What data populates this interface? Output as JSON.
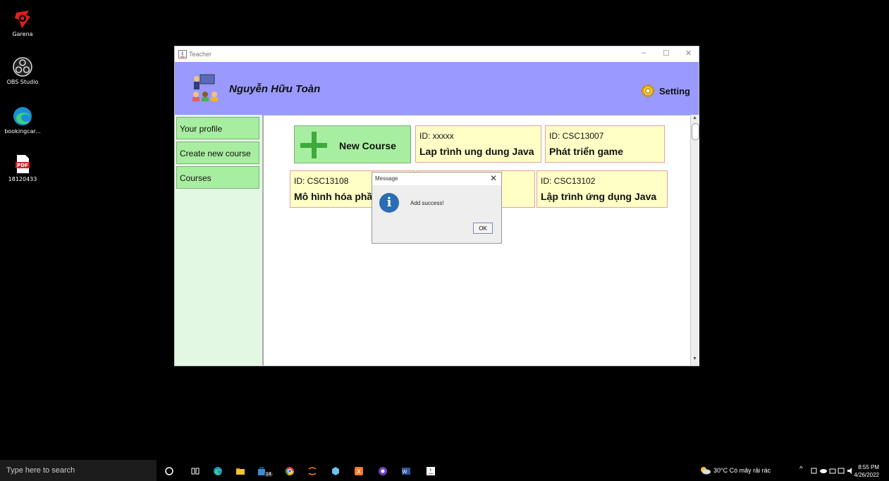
{
  "desktop": {
    "icons": [
      {
        "label": "Garena"
      },
      {
        "label": "OBS Studio"
      },
      {
        "label": "bookingcar..."
      },
      {
        "label": "18120433"
      }
    ]
  },
  "window": {
    "title": "Teacher",
    "controls": {
      "minimize": "–",
      "maximize": "☐",
      "close": "✕"
    },
    "header": {
      "user_name": "Nguyễn Hữu Toàn",
      "setting_label": "Setting"
    },
    "sidebar": {
      "items": [
        {
          "label": "Your profile"
        },
        {
          "label": "Create new course"
        },
        {
          "label": "Courses"
        }
      ]
    },
    "new_course": {
      "label": "New Course"
    },
    "courses": [
      {
        "id": "ID: xxxxx",
        "name": "Lap trình ung dung Java"
      },
      {
        "id": "ID: CSC13007",
        "name": "Phát triển game"
      },
      {
        "id": "ID: CSC13108",
        "name": "Mô hình hóa phầ"
      },
      {
        "id": "",
        "name": ""
      },
      {
        "id": "ID: CSC13102",
        "name": "Lập trình ứng dụng Java"
      }
    ]
  },
  "dialog": {
    "title": "Message",
    "close": "✕",
    "message": "Add success!",
    "ok_label": "OK",
    "icon": "info-icon"
  },
  "taskbar": {
    "search_placeholder": "Type here to search",
    "weather": "30°C  Có mây rải rác",
    "time": "8:55 PM",
    "date": "4/26/2022",
    "badge": "14"
  },
  "colors": {
    "header_bg": "#9999ff",
    "sidebar_bg": "#e3f8e3",
    "sidebar_button": "#a8eea0",
    "card_bg": "#ffffc6",
    "card_border": "#e6a0a0"
  }
}
